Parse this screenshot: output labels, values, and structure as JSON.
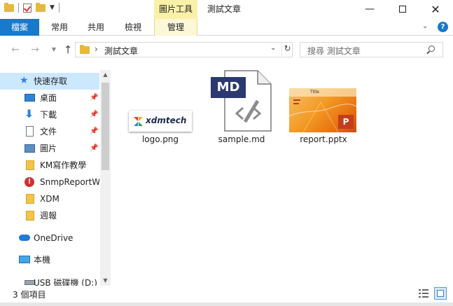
{
  "titlebar": {
    "context_tab_header": "圖片工具",
    "window_title": "測試文章",
    "minimize": "—",
    "maximize": "□",
    "close": "✕"
  },
  "ribbon": {
    "tabs": [
      "檔案",
      "常用",
      "共用",
      "檢視",
      "管理"
    ],
    "active_color": "#1979ca",
    "context_color": "#fbf0a8",
    "help": "?"
  },
  "address": {
    "path": "測試文章",
    "search_placeholder": "搜尋 測試文章"
  },
  "navpane": {
    "items": [
      {
        "label": "快速存取",
        "icon": "star-icon",
        "pinned": false
      },
      {
        "label": "桌面",
        "icon": "desktop-icon",
        "pinned": true
      },
      {
        "label": "下載",
        "icon": "download-icon",
        "pinned": true
      },
      {
        "label": "文件",
        "icon": "document-icon",
        "pinned": true
      },
      {
        "label": "圖片",
        "icon": "pictures-icon",
        "pinned": true
      },
      {
        "label": "KM寫作教學",
        "icon": "folder-icon",
        "pinned": false
      },
      {
        "label": "SnmpReportWe",
        "icon": "alert-folder-icon",
        "pinned": false
      },
      {
        "label": "XDM",
        "icon": "folder-icon",
        "pinned": false
      },
      {
        "label": "週報",
        "icon": "folder-icon",
        "pinned": false
      },
      {
        "label": "OneDrive",
        "icon": "cloud-icon",
        "pinned": false
      },
      {
        "label": "本機",
        "icon": "computer-icon",
        "pinned": false
      },
      {
        "label": "USB 磁碟機 (D:)",
        "icon": "usb-drive-icon",
        "pinned": false
      }
    ]
  },
  "files": [
    {
      "name": "logo.png",
      "logo_text": "xdmtech"
    },
    {
      "name": "sample.md",
      "banner": "MD"
    },
    {
      "name": "report.pptx",
      "slide_title": "Title",
      "badge": "P"
    }
  ],
  "status": {
    "count_text": "3 個項目"
  }
}
